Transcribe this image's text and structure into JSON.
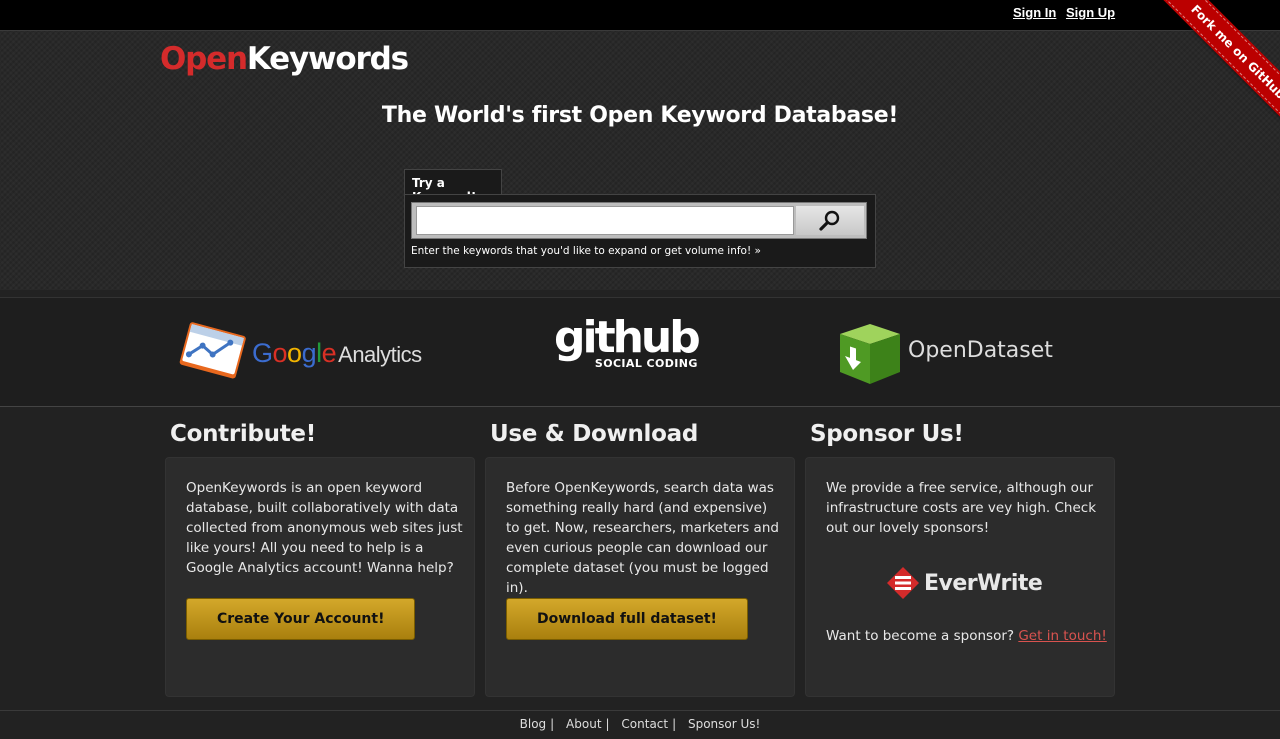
{
  "topbar": {
    "sign_in": "Sign In",
    "sign_up": "Sign Up"
  },
  "ribbon": {
    "label": "Fork me on GitHub"
  },
  "logo": {
    "part1": "Open",
    "part2": "Keywords"
  },
  "headline": "The World's first Open Keyword Database!",
  "search": {
    "tab_label": "Try a Keyword!",
    "value": "",
    "hint": "Enter the keywords that you'd like to expand or get volume info! »"
  },
  "partners": {
    "google_analytics": {
      "g1": "G",
      "g2": "o",
      "g3": "o",
      "g4": "g",
      "g5": "l",
      "g6": "e",
      "analytics": "Analytics"
    },
    "github": {
      "big": "github",
      "small": "SOCIAL CODING"
    },
    "opendataset": {
      "name": "OpenDataset"
    }
  },
  "columns": [
    {
      "title": "Contribute!",
      "text": "OpenKeywords is an open keyword database, built collaboratively with data collected from anonymous web sites just like yours! All you need to help is a Google Analytics account! Wanna help?",
      "button": "Create Your Account!"
    },
    {
      "title": "Use & Download",
      "text": "Before OpenKeywords, search data was something really hard (and expensive) to get. Now, researchers, marketers and even curious people can download our complete dataset (you must be logged in).",
      "button": "Download full dataset!"
    },
    {
      "title": "Sponsor Us!",
      "text": "We provide a free service, although our infrastructure costs are vey high. Check out our lovely sponsors!",
      "sponsor_name": "EverWrite",
      "cta_text": "Want to become a sponsor?",
      "cta_link": "Get in touch!"
    }
  ],
  "footer": {
    "links": [
      "Blog",
      "About",
      "Contact",
      "Sponsor Us!"
    ],
    "separator": "|"
  },
  "colors": {
    "brand_red": "#d42b2b",
    "button_gold": "#c49a1c",
    "link_red": "#d9534f"
  }
}
